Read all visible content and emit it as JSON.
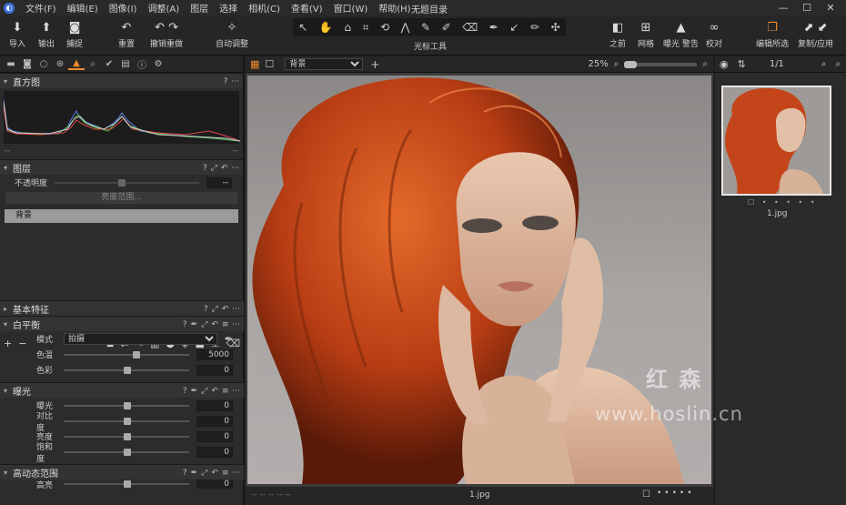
{
  "menu": {
    "items": [
      "文件(F)",
      "编辑(E)",
      "图像(I)",
      "调整(A)",
      "图层",
      "选择",
      "相机(C)",
      "查看(V)",
      "窗口(W)",
      "帮助(H)"
    ],
    "document_title": "无题目录"
  },
  "toolbar": {
    "import": "导入",
    "export": "输出",
    "capture": "捕捉",
    "reset": "重置",
    "undo_redo": "撤销重做",
    "auto_adjust": "自动调整",
    "cursor_tools": "光标工具",
    "before": "之前",
    "grid": "网格",
    "exposure_warning": "曝光 警告",
    "proof": "校对",
    "edit_selected": "编辑所选",
    "copy_apply": "复制/应用"
  },
  "panels": {
    "histogram": {
      "title": "直方图",
      "min": "--",
      "max": "--"
    },
    "layers": {
      "title": "图层",
      "opacity_label": "不透明度",
      "opacity_value": "--",
      "mask_range_button": "亮度范围...",
      "layer_name": "背景"
    },
    "basic": {
      "title": "基本特征"
    },
    "white_balance": {
      "title": "白平衡",
      "mode_label": "模式",
      "mode_value": "拍摄",
      "temp_label": "色温",
      "temp_value": "5000",
      "tint_label": "色彩",
      "tint_value": "0"
    },
    "exposure": {
      "title": "曝光",
      "rows": [
        {
          "label": "曝光",
          "value": "0"
        },
        {
          "label": "对比度",
          "value": "0"
        },
        {
          "label": "亮度",
          "value": "0"
        },
        {
          "label": "饱和度",
          "value": "0"
        }
      ]
    },
    "hdr": {
      "title": "高动态范围",
      "row_label": "高亮",
      "row_value": "0"
    }
  },
  "viewer": {
    "layer_select": "背景",
    "zoom": "25%",
    "filename": "1.jpg",
    "footer_left": "-- -- -- -- --"
  },
  "browser": {
    "count": "1/1",
    "thumb_name": "1.jpg"
  },
  "watermark": {
    "cn": "红 森 林",
    "url": "www.hoslin.cn"
  },
  "colors": {
    "accent": "#f08a2c",
    "hair": "#c4451a"
  }
}
